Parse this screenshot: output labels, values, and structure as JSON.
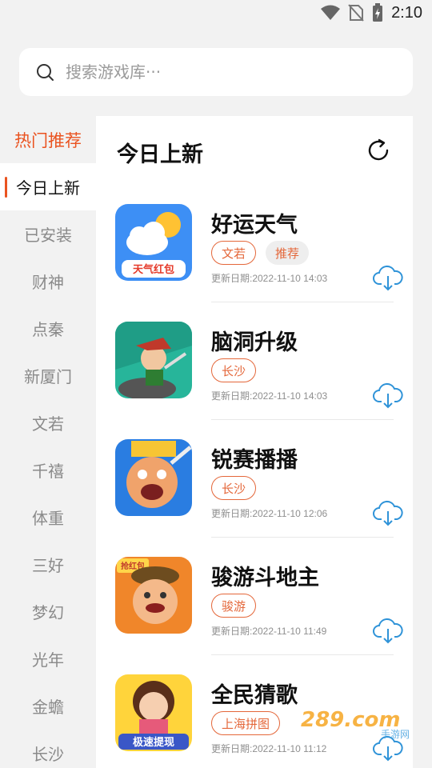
{
  "status": {
    "time": "2:10"
  },
  "search": {
    "placeholder": "搜索游戏库···"
  },
  "sidebar": {
    "items": [
      {
        "label": "热门推荐"
      },
      {
        "label": "今日上新"
      },
      {
        "label": "已安装"
      },
      {
        "label": "财神"
      },
      {
        "label": "点秦"
      },
      {
        "label": "新厦门"
      },
      {
        "label": "文若"
      },
      {
        "label": "千禧"
      },
      {
        "label": "体重"
      },
      {
        "label": "三好"
      },
      {
        "label": "梦幻"
      },
      {
        "label": "光年"
      },
      {
        "label": "金蟾"
      },
      {
        "label": "长沙"
      }
    ]
  },
  "main": {
    "title": "今日上新",
    "games": [
      {
        "name": "好运天气",
        "tags": [
          "文若",
          "推荐"
        ],
        "date": "更新日期:2022-11-10 14:03",
        "icon_text": "天气红包"
      },
      {
        "name": "脑洞升级",
        "tags": [
          "长沙"
        ],
        "date": "更新日期:2022-11-10 14:03"
      },
      {
        "name": "锐赛播播",
        "tags": [
          "长沙"
        ],
        "date": "更新日期:2022-11-10 12:06"
      },
      {
        "name": "骏游斗地主",
        "tags": [
          "骏游"
        ],
        "date": "更新日期:2022-11-10 11:49",
        "icon_text": "抢红包"
      },
      {
        "name": "全民猜歌",
        "tags": [
          "上海拼图"
        ],
        "date": "更新日期:2022-11-10 11:12",
        "icon_text": "极速提现"
      }
    ]
  },
  "watermark": {
    "text": "289.com",
    "sub": "手游网"
  },
  "colors": {
    "accent": "#ea5320",
    "download": "#2f93d8"
  }
}
